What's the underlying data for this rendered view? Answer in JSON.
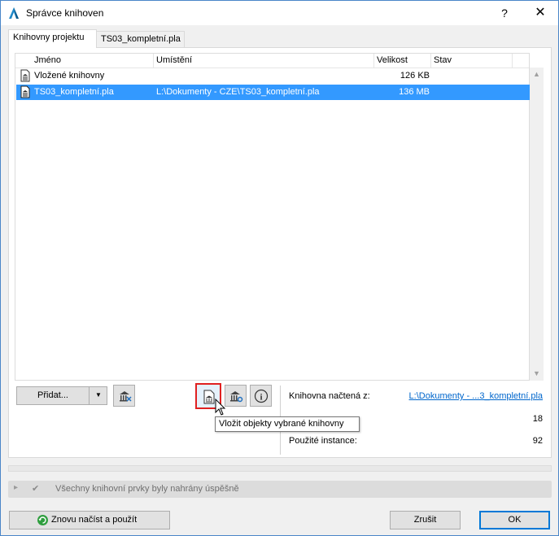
{
  "window": {
    "title": "Správce knihoven",
    "help_glyph": "?",
    "close_glyph": "✕"
  },
  "tabs": [
    {
      "label": "Knihovny projektu",
      "active": true
    },
    {
      "label": "TS03_kompletní.pla",
      "active": false
    }
  ],
  "list": {
    "columns": [
      "Jméno",
      "Umístění",
      "Velikost",
      "Stav"
    ],
    "rows": [
      {
        "name": "Vložené knihovny",
        "location": "",
        "size": "126 KB",
        "status": "",
        "selected": false,
        "icon": "library-file-icon"
      },
      {
        "name": "TS03_kompletní.pla",
        "location": "L:\\Dokumenty - CZE\\TS03_kompletní.pla",
        "size": "136 MB",
        "status": "",
        "selected": true,
        "icon": "library-file-icon"
      }
    ]
  },
  "toolbar": {
    "add_label": "Přidat...",
    "add_dropdown_glyph": "▼",
    "remove_library_icon": "library-remove-icon",
    "embed_library_icon": "embed-library-icon",
    "library_settings_icon": "library-settings-icon",
    "info_icon": "info-icon",
    "info_glyph": "i"
  },
  "tooltip": {
    "text": "Vložit objekty vybrané knihovny"
  },
  "details": {
    "loaded_from_label": "Knihovna načtená z:",
    "loaded_from_value": "L:\\Dokumenty - ...3_kompletní.pla",
    "used_objects_value": "18",
    "used_instances_label": "Použité instance:",
    "used_instances_value": "92"
  },
  "status": {
    "text": "Všechny knihovní prvky byly nahrány úspěšně",
    "expand_glyph": "▸",
    "check_glyph": "✔"
  },
  "buttons": {
    "reload_label": "Znovu načíst a použít",
    "cancel_label": "Zrušit",
    "ok_label": "OK"
  },
  "colors": {
    "selection": "#3399ff",
    "accent": "#0078d7",
    "highlight_border": "#e02020",
    "link": "#0066cc",
    "reload_icon": "#2e9e3e"
  }
}
